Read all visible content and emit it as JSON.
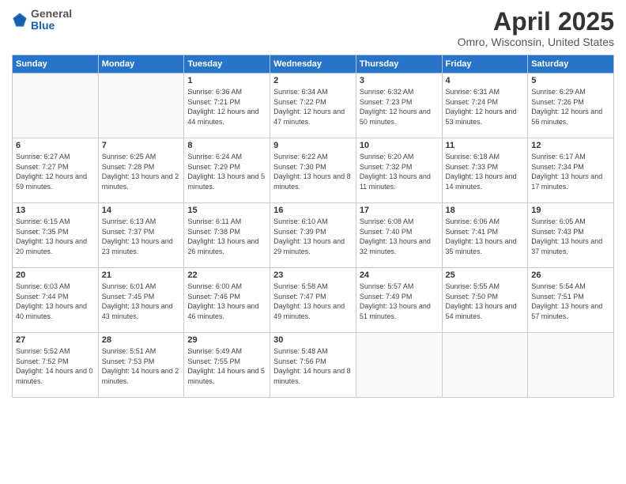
{
  "header": {
    "logo_general": "General",
    "logo_blue": "Blue",
    "month_title": "April 2025",
    "location": "Omro, Wisconsin, United States"
  },
  "days_of_week": [
    "Sunday",
    "Monday",
    "Tuesday",
    "Wednesday",
    "Thursday",
    "Friday",
    "Saturday"
  ],
  "weeks": [
    [
      {
        "day": "",
        "content": ""
      },
      {
        "day": "",
        "content": ""
      },
      {
        "day": "1",
        "content": "Sunrise: 6:36 AM\nSunset: 7:21 PM\nDaylight: 12 hours and 44 minutes."
      },
      {
        "day": "2",
        "content": "Sunrise: 6:34 AM\nSunset: 7:22 PM\nDaylight: 12 hours and 47 minutes."
      },
      {
        "day": "3",
        "content": "Sunrise: 6:32 AM\nSunset: 7:23 PM\nDaylight: 12 hours and 50 minutes."
      },
      {
        "day": "4",
        "content": "Sunrise: 6:31 AM\nSunset: 7:24 PM\nDaylight: 12 hours and 53 minutes."
      },
      {
        "day": "5",
        "content": "Sunrise: 6:29 AM\nSunset: 7:26 PM\nDaylight: 12 hours and 56 minutes."
      }
    ],
    [
      {
        "day": "6",
        "content": "Sunrise: 6:27 AM\nSunset: 7:27 PM\nDaylight: 12 hours and 59 minutes."
      },
      {
        "day": "7",
        "content": "Sunrise: 6:25 AM\nSunset: 7:28 PM\nDaylight: 13 hours and 2 minutes."
      },
      {
        "day": "8",
        "content": "Sunrise: 6:24 AM\nSunset: 7:29 PM\nDaylight: 13 hours and 5 minutes."
      },
      {
        "day": "9",
        "content": "Sunrise: 6:22 AM\nSunset: 7:30 PM\nDaylight: 13 hours and 8 minutes."
      },
      {
        "day": "10",
        "content": "Sunrise: 6:20 AM\nSunset: 7:32 PM\nDaylight: 13 hours and 11 minutes."
      },
      {
        "day": "11",
        "content": "Sunrise: 6:18 AM\nSunset: 7:33 PM\nDaylight: 13 hours and 14 minutes."
      },
      {
        "day": "12",
        "content": "Sunrise: 6:17 AM\nSunset: 7:34 PM\nDaylight: 13 hours and 17 minutes."
      }
    ],
    [
      {
        "day": "13",
        "content": "Sunrise: 6:15 AM\nSunset: 7:35 PM\nDaylight: 13 hours and 20 minutes."
      },
      {
        "day": "14",
        "content": "Sunrise: 6:13 AM\nSunset: 7:37 PM\nDaylight: 13 hours and 23 minutes."
      },
      {
        "day": "15",
        "content": "Sunrise: 6:11 AM\nSunset: 7:38 PM\nDaylight: 13 hours and 26 minutes."
      },
      {
        "day": "16",
        "content": "Sunrise: 6:10 AM\nSunset: 7:39 PM\nDaylight: 13 hours and 29 minutes."
      },
      {
        "day": "17",
        "content": "Sunrise: 6:08 AM\nSunset: 7:40 PM\nDaylight: 13 hours and 32 minutes."
      },
      {
        "day": "18",
        "content": "Sunrise: 6:06 AM\nSunset: 7:41 PM\nDaylight: 13 hours and 35 minutes."
      },
      {
        "day": "19",
        "content": "Sunrise: 6:05 AM\nSunset: 7:43 PM\nDaylight: 13 hours and 37 minutes."
      }
    ],
    [
      {
        "day": "20",
        "content": "Sunrise: 6:03 AM\nSunset: 7:44 PM\nDaylight: 13 hours and 40 minutes."
      },
      {
        "day": "21",
        "content": "Sunrise: 6:01 AM\nSunset: 7:45 PM\nDaylight: 13 hours and 43 minutes."
      },
      {
        "day": "22",
        "content": "Sunrise: 6:00 AM\nSunset: 7:46 PM\nDaylight: 13 hours and 46 minutes."
      },
      {
        "day": "23",
        "content": "Sunrise: 5:58 AM\nSunset: 7:47 PM\nDaylight: 13 hours and 49 minutes."
      },
      {
        "day": "24",
        "content": "Sunrise: 5:57 AM\nSunset: 7:49 PM\nDaylight: 13 hours and 51 minutes."
      },
      {
        "day": "25",
        "content": "Sunrise: 5:55 AM\nSunset: 7:50 PM\nDaylight: 13 hours and 54 minutes."
      },
      {
        "day": "26",
        "content": "Sunrise: 5:54 AM\nSunset: 7:51 PM\nDaylight: 13 hours and 57 minutes."
      }
    ],
    [
      {
        "day": "27",
        "content": "Sunrise: 5:52 AM\nSunset: 7:52 PM\nDaylight: 14 hours and 0 minutes."
      },
      {
        "day": "28",
        "content": "Sunrise: 5:51 AM\nSunset: 7:53 PM\nDaylight: 14 hours and 2 minutes."
      },
      {
        "day": "29",
        "content": "Sunrise: 5:49 AM\nSunset: 7:55 PM\nDaylight: 14 hours and 5 minutes."
      },
      {
        "day": "30",
        "content": "Sunrise: 5:48 AM\nSunset: 7:56 PM\nDaylight: 14 hours and 8 minutes."
      },
      {
        "day": "",
        "content": ""
      },
      {
        "day": "",
        "content": ""
      },
      {
        "day": "",
        "content": ""
      }
    ]
  ]
}
